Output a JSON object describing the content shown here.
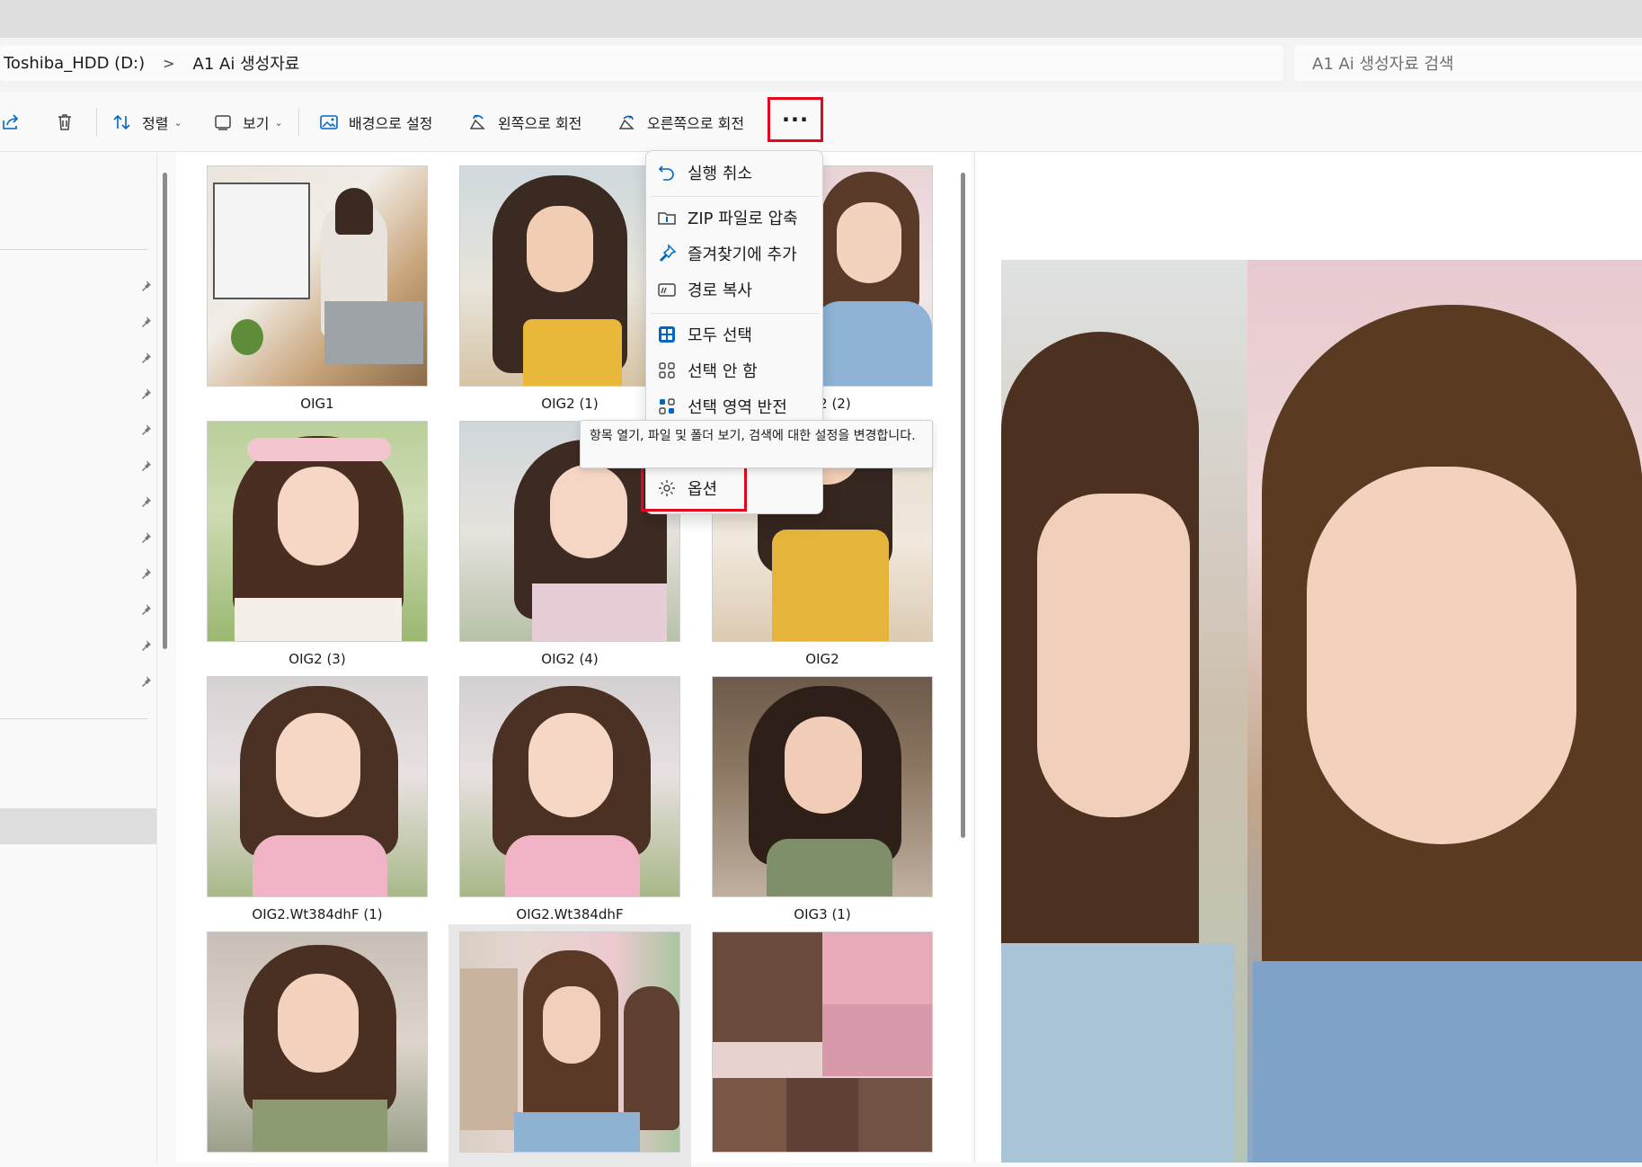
{
  "address": {
    "crumbs": [
      "Toshiba_HDD (D:)",
      "A1 Ai 생성자료"
    ],
    "separator": ">",
    "search_placeholder": "A1 Ai 생성자료 검색"
  },
  "toolbar": {
    "sort_label": "정렬",
    "view_label": "보기",
    "set_background_label": "배경으로 설정",
    "rotate_left_label": "왼쪽으로 회전",
    "rotate_right_label": "오른쪽으로 회전",
    "more_label": "···",
    "chevron": "⌄"
  },
  "menu": {
    "undo": "실행 취소",
    "zip": "ZIP 파일로 압축",
    "favorites": "즐겨찾기에 추가",
    "copy_path": "경로 복사",
    "select_all": "모두 선택",
    "select_none": "선택 안 함",
    "invert_selection": "선택 영역 반전",
    "options": "옵션"
  },
  "tooltip": "항목 열기, 파일 및 폴더 보기, 검색에 대한 설정을 변경합니다.",
  "files": [
    {
      "name": "OIG1"
    },
    {
      "name": "OIG2 (1)"
    },
    {
      "name": "OIG2 (2)"
    },
    {
      "name": "OIG2 (3)"
    },
    {
      "name": "OIG2 (4)"
    },
    {
      "name": "OIG2"
    },
    {
      "name": "OIG2.Wt384dhF (1)"
    },
    {
      "name": "OIG2.Wt384dhF"
    },
    {
      "name": "OIG3 (1)"
    },
    {
      "name": ""
    },
    {
      "name": ""
    },
    {
      "name": ""
    }
  ],
  "colors": {
    "highlight_red": "#e3061d",
    "accent_blue": "#0067c0"
  }
}
